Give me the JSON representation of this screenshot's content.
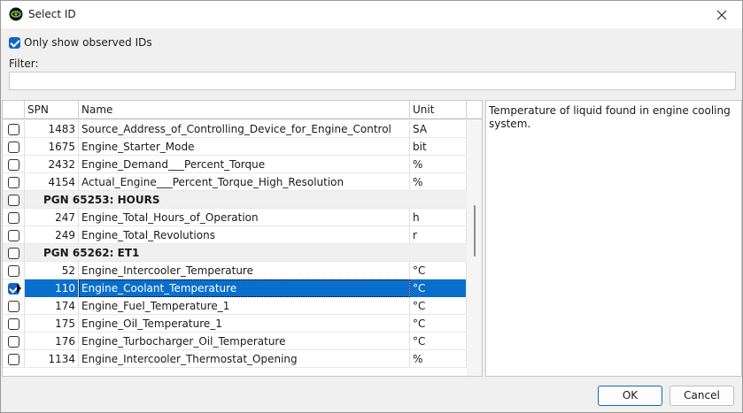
{
  "window": {
    "title": "Select ID"
  },
  "options": {
    "only_observed_label": "Only show observed IDs",
    "only_observed_checked": true
  },
  "filter": {
    "label": "Filter:",
    "value": "",
    "placeholder": ""
  },
  "grid": {
    "columns": {
      "spn": "SPN",
      "name": "Name",
      "unit": "Unit"
    },
    "rows": [
      {
        "type": "item",
        "checked": false,
        "spn": "1483",
        "name": "Source_Address_of_Controlling_Device_for_Engine_Control",
        "unit": "SA"
      },
      {
        "type": "item",
        "checked": false,
        "spn": "1675",
        "name": "Engine_Starter_Mode",
        "unit": "bit"
      },
      {
        "type": "item",
        "checked": false,
        "spn": "2432",
        "name": "Engine_Demand___Percent_Torque",
        "unit": "%"
      },
      {
        "type": "item",
        "checked": false,
        "spn": "4154",
        "name": "Actual_Engine___Percent_Torque_High_Resolution",
        "unit": "%"
      },
      {
        "type": "group",
        "checked": false,
        "label": "PGN 65253: HOURS"
      },
      {
        "type": "item",
        "checked": false,
        "spn": "247",
        "name": "Engine_Total_Hours_of_Operation",
        "unit": "h"
      },
      {
        "type": "item",
        "checked": false,
        "spn": "249",
        "name": "Engine_Total_Revolutions",
        "unit": "r"
      },
      {
        "type": "group",
        "checked": false,
        "label": "PGN 65262: ET1"
      },
      {
        "type": "item",
        "checked": false,
        "spn": "52",
        "name": "Engine_Intercooler_Temperature",
        "unit": "°C"
      },
      {
        "type": "item",
        "checked": true,
        "selected": true,
        "spn": "110",
        "name": "Engine_Coolant_Temperature",
        "unit": "°C"
      },
      {
        "type": "item",
        "checked": false,
        "spn": "174",
        "name": "Engine_Fuel_Temperature_1",
        "unit": "°C"
      },
      {
        "type": "item",
        "checked": false,
        "spn": "175",
        "name": "Engine_Oil_Temperature_1",
        "unit": "°C"
      },
      {
        "type": "item",
        "checked": false,
        "spn": "176",
        "name": "Engine_Turbocharger_Oil_Temperature",
        "unit": "°C"
      },
      {
        "type": "item",
        "checked": false,
        "spn": "1134",
        "name": "Engine_Intercooler_Thermostat_Opening",
        "unit": "%"
      }
    ]
  },
  "description": "Temperature of liquid found in engine cooling system.",
  "buttons": {
    "ok": "OK",
    "cancel": "Cancel"
  },
  "colors": {
    "accent": "#0a6fcc",
    "checkbox": "#1565c0"
  },
  "icons": {
    "app": "app-logo-icon",
    "close": "close-icon",
    "row_marker": "current-row-arrow-icon"
  }
}
